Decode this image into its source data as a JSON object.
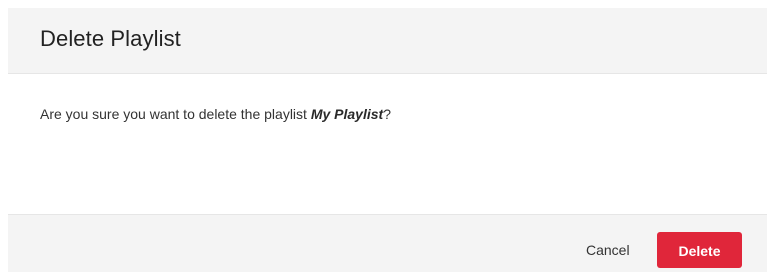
{
  "dialog": {
    "title": "Delete Playlist",
    "message_prefix": "Are you sure you want to delete the playlist ",
    "playlist_name": "My Playlist",
    "message_suffix": "?",
    "cancel_label": "Cancel",
    "delete_label": "Delete"
  },
  "colors": {
    "header_bg": "#f4f4f4",
    "footer_bg": "#f4f4f4",
    "delete_button_bg": "#e0263a",
    "delete_button_text": "#ffffff"
  }
}
